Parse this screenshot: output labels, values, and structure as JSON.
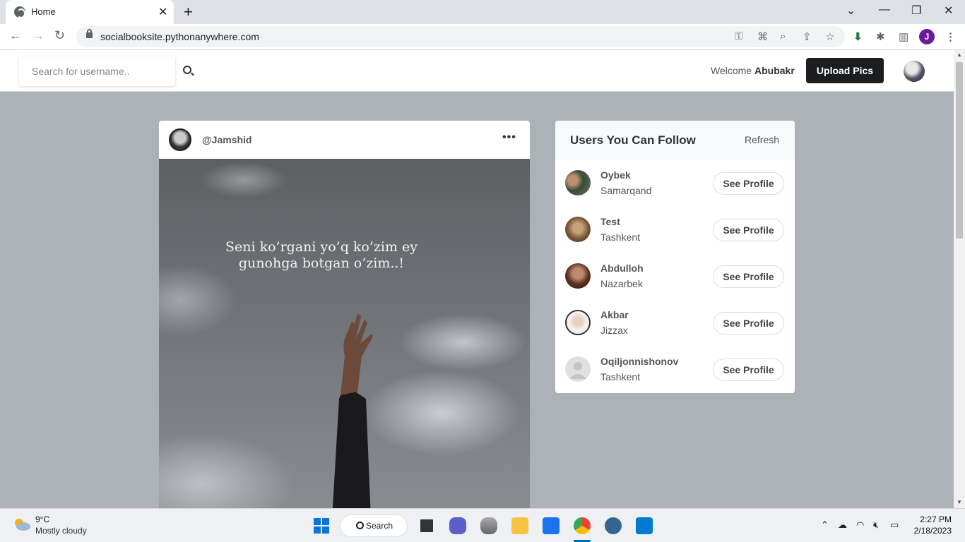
{
  "browser": {
    "tab_title": "Home",
    "url": "socialbooksite.pythonanywhere.com",
    "profile_initial": "J"
  },
  "header": {
    "search_placeholder": "Search for username..",
    "welcome_prefix": "Welcome",
    "welcome_name": "Abubakr",
    "upload_label": "Upload Pics"
  },
  "post": {
    "username": "@Jamshid",
    "caption_line1": "Seni ko’rgani yo’q ko’zim ey",
    "caption_line2": "gunohga botgan o’zim..!"
  },
  "follow": {
    "title": "Users You Can Follow",
    "refresh_label": "Refresh",
    "button_label": "See Profile",
    "users": [
      {
        "name": "Oybek",
        "city": "Samarqand"
      },
      {
        "name": "Test",
        "city": "Tashkent"
      },
      {
        "name": "Abdulloh",
        "city": "Nazarbek"
      },
      {
        "name": "Akbar",
        "city": "Jizzax"
      },
      {
        "name": "Oqiljonnishonov",
        "city": "Tashkent"
      }
    ]
  },
  "taskbar": {
    "temperature": "9°C",
    "condition": "Mostly cloudy",
    "search_label": "Search",
    "time": "2:27 PM",
    "date": "2/18/2023"
  }
}
